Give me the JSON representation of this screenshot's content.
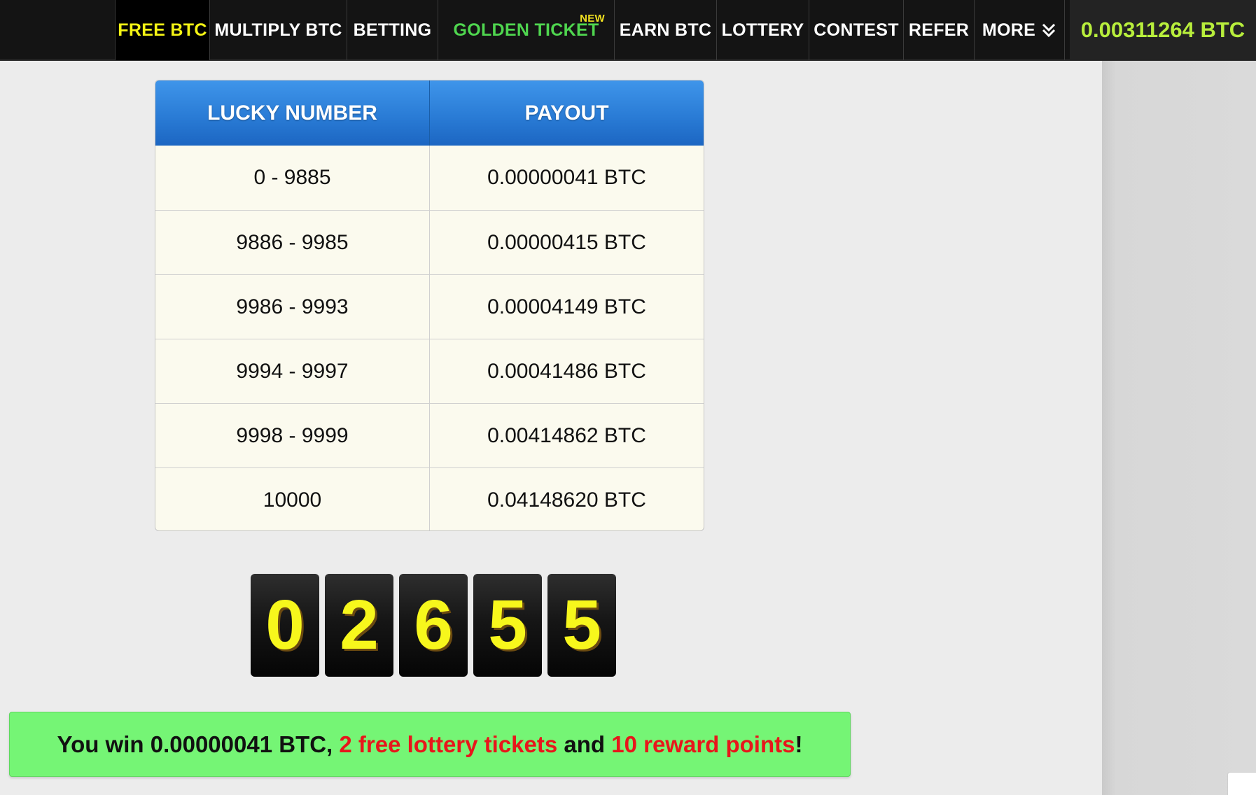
{
  "nav": {
    "items": [
      {
        "label": "FREE BTC"
      },
      {
        "label": "MULTIPLY BTC"
      },
      {
        "label": "BETTING"
      },
      {
        "label": "GOLDEN TICKET",
        "badge": "NEW"
      },
      {
        "label": "EARN BTC"
      },
      {
        "label": "LOTTERY"
      },
      {
        "label": "CONTEST"
      },
      {
        "label": "REFER"
      },
      {
        "label": "MORE",
        "icon": "double-chevron-down-icon"
      }
    ],
    "balance": "0.00311264 BTC"
  },
  "payout_table": {
    "headers": [
      "LUCKY NUMBER",
      "PAYOUT"
    ],
    "rows": [
      [
        "0 - 9885",
        "0.00000041 BTC"
      ],
      [
        "9886 - 9985",
        "0.00000415 BTC"
      ],
      [
        "9986 - 9993",
        "0.00004149 BTC"
      ],
      [
        "9994 - 9997",
        "0.00041486 BTC"
      ],
      [
        "9998 - 9999",
        "0.00414862 BTC"
      ],
      [
        "10000",
        "0.04148620 BTC"
      ]
    ]
  },
  "lucky_number": {
    "digits": [
      "0",
      "2",
      "6",
      "5",
      "5"
    ]
  },
  "win_message": {
    "prefix": "You win 0.00000041 BTC, ",
    "tickets": "2 free lottery tickets",
    "middle": " and ",
    "points": "10 reward points",
    "suffix": "!"
  },
  "colors": {
    "active_nav": "#f4f414",
    "golden_ticket": "#4fd64f",
    "balance": "#b8ee3c",
    "table_header": "#2a7cd6",
    "digit_text": "#f7f71c",
    "win_background": "#75f575",
    "win_highlight": "#e8161b"
  }
}
